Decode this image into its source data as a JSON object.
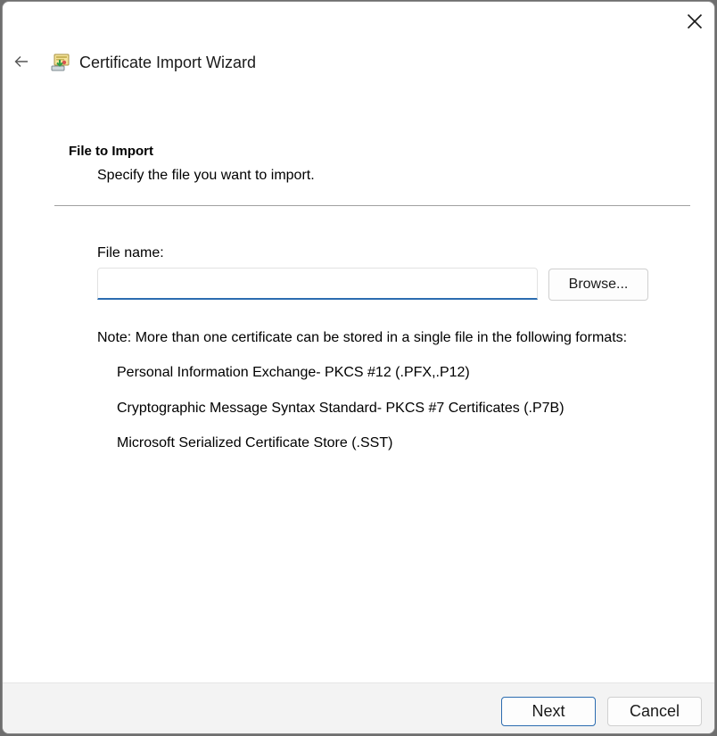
{
  "window": {
    "title": "Certificate Import Wizard"
  },
  "page": {
    "section_title": "File to Import",
    "section_subtitle": "Specify the file you want to import."
  },
  "file": {
    "label": "File name:",
    "value": "",
    "placeholder": "",
    "browse_label": "Browse..."
  },
  "note": {
    "text": "Note:  More than one certificate can be stored in a single file in the following formats:",
    "formats": [
      "Personal Information Exchange- PKCS #12 (.PFX,.P12)",
      "Cryptographic Message Syntax Standard- PKCS #7 Certificates (.P7B)",
      "Microsoft Serialized Certificate Store (.SST)"
    ]
  },
  "footer": {
    "next_label": "Next",
    "cancel_label": "Cancel"
  },
  "icons": {
    "close": "close-icon",
    "back": "back-arrow-icon",
    "app": "certificate-icon"
  },
  "colors": {
    "accent": "#2b6cb0",
    "footer_bg": "#f3f3f3",
    "divider": "#a0a0a0"
  }
}
